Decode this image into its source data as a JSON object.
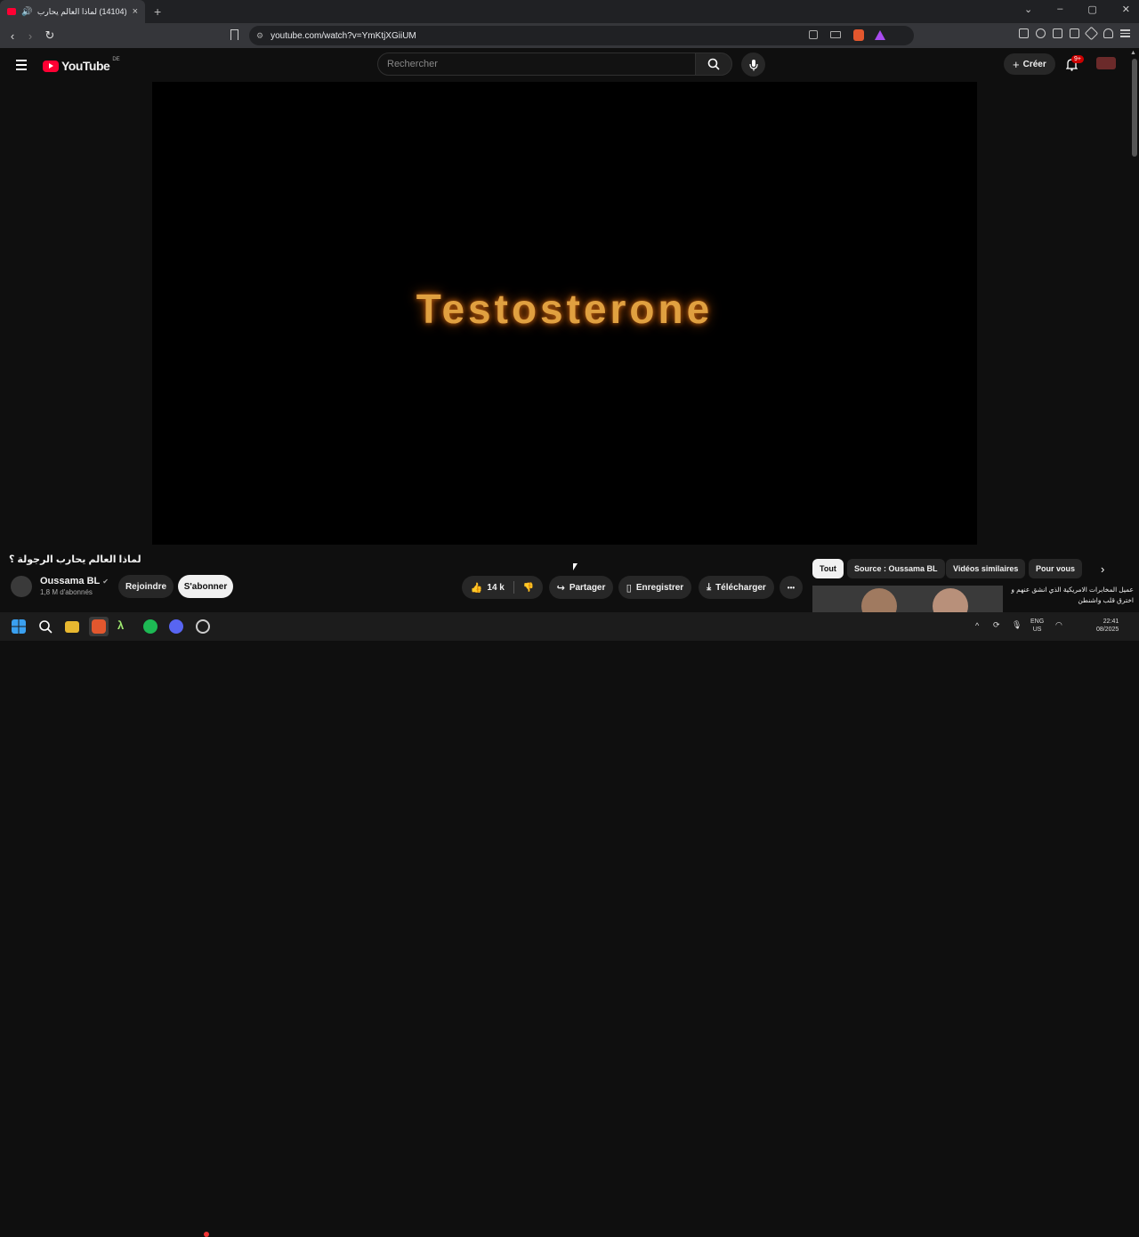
{
  "browser": {
    "tab": {
      "title": "(14104) لماذا العالم يحارب الرجـ",
      "close": "×",
      "audio_icon": "speaker-icon"
    },
    "new_tab": "+",
    "window_controls": [
      "⌄",
      "–",
      "▢",
      "✕"
    ],
    "url": "youtube.com/watch?v=YmKtjXGiiUM"
  },
  "header": {
    "logo_text": "YouTube",
    "country": "DE",
    "search_placeholder": "Rechercher",
    "create_label": "Créer",
    "notif_count": "9+"
  },
  "player": {
    "overlay_text": "Testosterone"
  },
  "video": {
    "title": "لماذا العالم يحارب الرجولة ؟",
    "channel": "Oussama BL",
    "subscribers": "1,8 M d'abonnés",
    "join_label": "Rejoindre",
    "subscribe_label": "S'abonner",
    "likes": "14 k",
    "share_label": "Partager",
    "save_label": "Enregistrer",
    "download_label": "Télécharger",
    "more_label": "•••"
  },
  "chips": [
    "Tout",
    "Source : Oussama BL",
    "Vidéos similaires",
    "Pour vous"
  ],
  "recommendation": {
    "title": "عميل المخابرات الامريكية الذي انشق عنهم و اخترق قلب واشنطن"
  },
  "taskbar": {
    "lang": "ENG",
    "region": "US",
    "time": "22:41",
    "date": "08/2025"
  },
  "colors": {
    "accent": "#ff0033",
    "background": "#0f0f0f",
    "video_glow": "#e0a040"
  }
}
